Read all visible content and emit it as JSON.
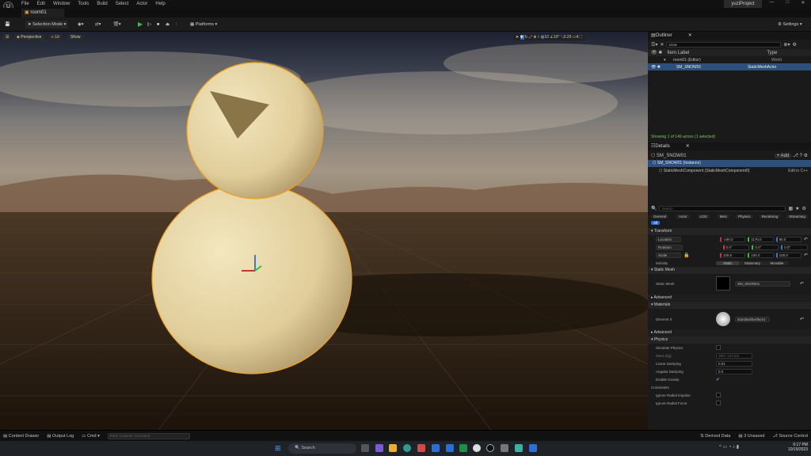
{
  "menu": {
    "items": [
      "File",
      "Edit",
      "Window",
      "Tools",
      "Build",
      "Select",
      "Actor",
      "Help"
    ],
    "project": "yuziProject"
  },
  "tab": {
    "label": "room01"
  },
  "toolbar": {
    "mode": "Selection Mode",
    "platforms": "Platforms",
    "settings": "Settings"
  },
  "viewport": {
    "perspective": "Perspective",
    "lit": "Lit",
    "show": "Show",
    "grid_snap": "10",
    "rot_snap": "10°",
    "scale_snap": "0.25",
    "cam_speed": "4"
  },
  "outliner": {
    "title": "Outliner",
    "search_value": "snow",
    "col_label": "Item Label",
    "col_type": "Type",
    "rows": [
      {
        "label": "room01 (Editor)",
        "type": "World"
      },
      {
        "label": "SM_SNOW01",
        "type": "StaticMeshActor"
      }
    ],
    "status": "Showing 1 of 149 actors (1 selected)"
  },
  "details": {
    "title": "Details",
    "actor": "SM_SNOW01",
    "add": "+ Add",
    "instance": "SM_SNOW01 (Instance)",
    "component": "StaticMeshComponent (StaticMeshComponent0)",
    "edit_cpp": "Edit in C++",
    "search_placeholder": "Search",
    "cats": [
      "General",
      "Actor",
      "LOD",
      "Misc",
      "Physics",
      "Rendering",
      "Streaming"
    ],
    "all": "All",
    "transform": "Transform",
    "location": {
      "label": "Location",
      "x": "-190.0",
      "y": "1170.0",
      "z": "90.0"
    },
    "rotation": {
      "label": "Rotation",
      "x": "0.0°",
      "y": "0.0°",
      "z": "0.0°"
    },
    "scale": {
      "label": "Scale",
      "x": "100.0",
      "y": "100.0",
      "z": "100.0"
    },
    "mobility": {
      "label": "Mobility",
      "static": "Static",
      "stationary": "Stationary",
      "movable": "Movable"
    },
    "static_mesh_section": "Static Mesh",
    "static_mesh_label": "Static Mesh",
    "static_mesh_value": "SM_SNOW01",
    "advanced": "Advanced",
    "materials": "Materials",
    "element0": "Element 0",
    "material_value": "standardSurface1",
    "advanced2": "Advanced",
    "physics": "Physics",
    "simulate": "Simulate Physics",
    "mass": "Mass (kg)",
    "mass_value": "2907.237183",
    "linear_damping": "Linear Damping",
    "linear_value": "0.01",
    "angular_damping": "Angular Damping",
    "angular_value": "0.0",
    "gravity": "Enable Gravity",
    "constraints": "Constraints",
    "ignore_radial_impulse": "Ignore Radial Impulse",
    "ignore_radial_force": "Ignore Radial Force"
  },
  "statusbar": {
    "content_drawer": "Content Drawer",
    "output_log": "Output Log",
    "cmd": "Cmd",
    "console_placeholder": "Enter Console Command",
    "derived": "Derived Data",
    "unsaved": "3 Unsaved",
    "source": "Source Control"
  },
  "taskbar": {
    "search": "Search",
    "time": "6:17 PM",
    "date": "10/19/2023"
  }
}
